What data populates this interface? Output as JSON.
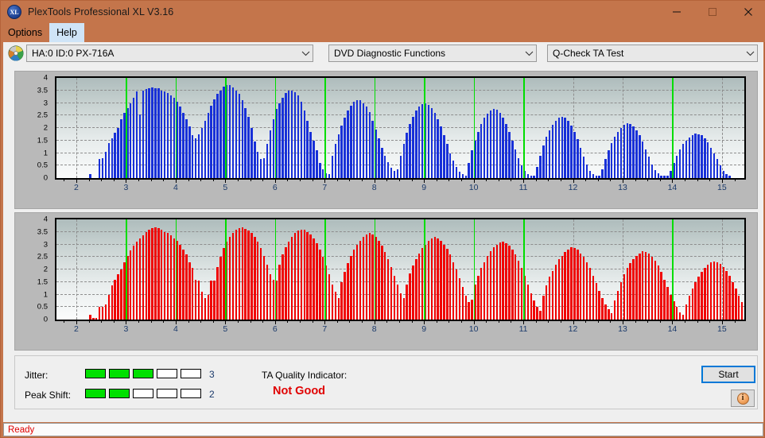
{
  "window": {
    "title": "PlexTools Professional XL V3.16",
    "app_icon": "xl-app-icon",
    "icon_text": "XL",
    "minimize": "minimize-icon",
    "maximize": "maximize-icon",
    "close": "close-icon",
    "accent_color": "#c4754b"
  },
  "menu": {
    "items": [
      {
        "label": "Options",
        "hover": false
      },
      {
        "label": "Help",
        "hover": true
      }
    ]
  },
  "toolbar": {
    "drive": {
      "value": "HA:0 ID:0  PX-716A",
      "icon": "disc-icon"
    },
    "function": {
      "value": "DVD Diagnostic Functions"
    },
    "test": {
      "value": "Q-Check TA Test"
    },
    "arrow_glyph": "⌄"
  },
  "footer": {
    "jitter_label": "Jitter:",
    "jitter_value": "3",
    "jitter_segments": 5,
    "jitter_filled": 3,
    "peak_label": "Peak Shift:",
    "peak_value": "2",
    "peak_segments": 5,
    "peak_filled": 2,
    "ta_label": "TA Quality Indicator:",
    "ta_verdict": "Not Good",
    "ta_verdict_color": "#e00000",
    "meter_on_color": "#00e000",
    "start_label": "Start",
    "info_glyph": "i"
  },
  "statusbar": {
    "text": "Ready",
    "color": "#e00000"
  },
  "chart_data": [
    {
      "id": "ta-test-jitter",
      "type": "bar",
      "title": "",
      "xlabel": "",
      "ylabel": "",
      "color": "#1830d8",
      "xlim": [
        1.6,
        15.45
      ],
      "ylim": [
        0,
        4
      ],
      "yticks": [
        0,
        0.5,
        1,
        1.5,
        2,
        2.5,
        3,
        3.5,
        4
      ],
      "ytick_labels": [
        "0",
        "0.5",
        "1",
        "1.5",
        "2",
        "2.5",
        "3",
        "3.5",
        "4"
      ],
      "xticks": [
        2,
        3,
        4,
        5,
        6,
        7,
        8,
        9,
        10,
        11,
        12,
        13,
        14,
        15
      ],
      "xtick_labels": [
        "2",
        "3",
        "4",
        "5",
        "6",
        "7",
        "8",
        "9",
        "10",
        "11",
        "12",
        "13",
        "14",
        "15"
      ],
      "grid": true,
      "markers": [
        3,
        4,
        5,
        6,
        7,
        8,
        9,
        10,
        11,
        14
      ],
      "marker_color": "#00dd00",
      "bar_step": 0.0625,
      "x_start": 2.28,
      "values": [
        0.15,
        0,
        0,
        0.75,
        0.78,
        1.05,
        1.4,
        1.6,
        1.8,
        2.0,
        2.35,
        2.6,
        2.8,
        3.0,
        3.2,
        3.45,
        2.55,
        3.5,
        3.55,
        3.6,
        3.62,
        3.6,
        3.58,
        3.5,
        3.45,
        3.4,
        3.3,
        3.2,
        3.05,
        2.85,
        2.6,
        2.35,
        2.05,
        1.7,
        1.6,
        1.75,
        2.0,
        2.3,
        2.6,
        2.9,
        3.15,
        3.35,
        3.5,
        3.65,
        3.72,
        3.7,
        3.62,
        3.5,
        3.35,
        3.1,
        2.8,
        2.45,
        2.0,
        1.45,
        1.05,
        0.75,
        0.8,
        1.35,
        1.9,
        2.35,
        2.75,
        3.0,
        3.2,
        3.4,
        3.5,
        3.48,
        3.42,
        3.3,
        3.05,
        2.7,
        2.3,
        1.85,
        1.5,
        1.1,
        0.6,
        0.35,
        0.2,
        0.15,
        0.9,
        1.35,
        1.75,
        2.1,
        2.4,
        2.7,
        2.9,
        3.05,
        3.12,
        3.1,
        3.0,
        2.85,
        2.62,
        2.3,
        1.95,
        1.6,
        1.2,
        0.9,
        0.65,
        0.4,
        0.3,
        0.35,
        0.9,
        1.35,
        1.8,
        2.15,
        2.45,
        2.7,
        2.85,
        2.95,
        2.98,
        2.92,
        2.8,
        2.6,
        2.35,
        2.05,
        1.7,
        1.35,
        1.0,
        0.7,
        0.45,
        0.25,
        0.15,
        0.1,
        0.6,
        1.1,
        1.5,
        1.85,
        2.15,
        2.4,
        2.58,
        2.7,
        2.76,
        2.72,
        2.6,
        2.42,
        2.15,
        1.85,
        1.5,
        1.15,
        0.8,
        0.5,
        0.28,
        0.15,
        0.1,
        0.08,
        0.45,
        0.9,
        1.3,
        1.65,
        1.9,
        2.12,
        2.3,
        2.4,
        2.45,
        2.42,
        2.3,
        2.1,
        1.85,
        1.55,
        1.2,
        0.85,
        0.55,
        0.3,
        0.15,
        0.1,
        0.08,
        0.35,
        0.75,
        1.1,
        1.4,
        1.65,
        1.85,
        2.0,
        2.12,
        2.18,
        2.15,
        2.05,
        1.9,
        1.7,
        1.45,
        1.15,
        0.85,
        0.55,
        0.32,
        0.18,
        0.1,
        0.08,
        0.08,
        0.3,
        0.6,
        0.9,
        1.15,
        1.35,
        1.5,
        1.62,
        1.72,
        1.78,
        1.76,
        1.7,
        1.58,
        1.42,
        1.22,
        1.0,
        0.75,
        0.5,
        0.3,
        0.15,
        0.08,
        0,
        0,
        0,
        0,
        0,
        0,
        0,
        0,
        0,
        0,
        0,
        0,
        0,
        0,
        0,
        0,
        0,
        0,
        0,
        0,
        0,
        0,
        0,
        0,
        0,
        0,
        0,
        0,
        0,
        0,
        0,
        0,
        0,
        0,
        0,
        0,
        0,
        0,
        0,
        0,
        0,
        0,
        0,
        0,
        0,
        0,
        0,
        0,
        0,
        0.85,
        0.25,
        0.45,
        0.7,
        1.0,
        1.35,
        1.65,
        1.9,
        2.05,
        2.1,
        2.0,
        1.9,
        1.75,
        1.5,
        1.2,
        0.9,
        0.65,
        0,
        0,
        0,
        0,
        0,
        0,
        0,
        0,
        0,
        0,
        0,
        0,
        0,
        0,
        0,
        0,
        0,
        0,
        0,
        0,
        0,
        0,
        0,
        0,
        0,
        0,
        0,
        0,
        0,
        0,
        0,
        0,
        0,
        0,
        0
      ]
    },
    {
      "id": "ta-test-peak-shift",
      "type": "bar",
      "title": "",
      "xlabel": "",
      "ylabel": "",
      "color": "#f00000",
      "xlim": [
        1.6,
        15.45
      ],
      "ylim": [
        0,
        4
      ],
      "yticks": [
        0,
        0.5,
        1,
        1.5,
        2,
        2.5,
        3,
        3.5,
        4
      ],
      "ytick_labels": [
        "0",
        "0.5",
        "1",
        "1.5",
        "2",
        "2.5",
        "3",
        "3.5",
        "4"
      ],
      "xticks": [
        2,
        3,
        4,
        5,
        6,
        7,
        8,
        9,
        10,
        11,
        12,
        13,
        14,
        15
      ],
      "xtick_labels": [
        "2",
        "3",
        "4",
        "5",
        "6",
        "7",
        "8",
        "9",
        "10",
        "11",
        "12",
        "13",
        "14",
        "15"
      ],
      "grid": true,
      "markers": [
        3,
        4,
        5,
        6,
        7,
        8,
        9,
        10,
        11,
        14
      ],
      "marker_color": "#00dd00",
      "bar_step": 0.0625,
      "x_start": 2.28,
      "values": [
        0.18,
        0.05,
        0.05,
        0.5,
        0.5,
        0.6,
        1.0,
        1.35,
        1.6,
        1.8,
        2.0,
        2.3,
        2.55,
        2.75,
        2.95,
        3.1,
        3.25,
        3.35,
        3.5,
        3.6,
        3.65,
        3.68,
        3.65,
        3.6,
        3.5,
        3.45,
        3.35,
        3.25,
        3.15,
        3.0,
        2.8,
        2.6,
        2.3,
        2.05,
        1.6,
        1.55,
        1.1,
        0.85,
        1.0,
        1.55,
        1.55,
        2.1,
        2.5,
        2.85,
        3.1,
        3.3,
        3.45,
        3.58,
        3.65,
        3.68,
        3.62,
        3.55,
        3.45,
        3.3,
        3.1,
        2.85,
        2.55,
        2.2,
        1.8,
        1.6,
        1.55,
        2.2,
        2.6,
        2.9,
        3.1,
        3.3,
        3.45,
        3.55,
        3.6,
        3.58,
        3.5,
        3.4,
        3.25,
        3.05,
        2.8,
        2.5,
        2.15,
        1.8,
        1.4,
        1.1,
        0.85,
        1.5,
        1.9,
        2.25,
        2.55,
        2.8,
        3.0,
        3.15,
        3.3,
        3.4,
        3.45,
        3.4,
        3.3,
        3.15,
        2.95,
        2.7,
        2.4,
        2.1,
        1.75,
        1.4,
        1.05,
        0.85,
        1.4,
        1.85,
        2.15,
        2.4,
        2.65,
        2.85,
        3.0,
        3.15,
        3.25,
        3.3,
        3.25,
        3.15,
        3.0,
        2.82,
        2.6,
        2.3,
        2.0,
        1.65,
        1.3,
        0.95,
        0.7,
        0.8,
        1.4,
        1.75,
        2.05,
        2.3,
        2.55,
        2.72,
        2.88,
        3.0,
        3.08,
        3.1,
        3.05,
        2.95,
        2.8,
        2.6,
        2.35,
        2.05,
        1.75,
        1.4,
        1.05,
        0.75,
        0.5,
        0.35,
        0.95,
        1.35,
        1.7,
        1.95,
        2.2,
        2.4,
        2.55,
        2.7,
        2.8,
        2.88,
        2.85,
        2.78,
        2.65,
        2.5,
        2.3,
        2.05,
        1.75,
        1.45,
        1.15,
        0.85,
        0.6,
        0.4,
        0.25,
        0.75,
        1.15,
        1.5,
        1.8,
        2.05,
        2.25,
        2.4,
        2.55,
        2.65,
        2.72,
        2.7,
        2.62,
        2.5,
        2.35,
        2.15,
        1.9,
        1.6,
        1.3,
        1.0,
        0.72,
        0.5,
        0.3,
        0.18,
        0.6,
        0.95,
        1.25,
        1.5,
        1.72,
        1.9,
        2.05,
        2.18,
        2.28,
        2.32,
        2.3,
        2.22,
        2.1,
        1.95,
        1.75,
        1.5,
        1.25,
        0.95,
        0.7,
        0.5,
        0.3,
        0.18,
        0.1,
        0.75,
        0,
        0.2,
        0.6,
        0.9,
        1.15,
        1.35,
        1.5,
        1.6,
        1.65,
        1.65,
        1.6,
        1.5,
        1.35,
        1.15,
        0.9,
        0.65,
        0.75,
        0.12,
        0,
        0,
        0,
        0,
        0,
        0,
        0,
        0,
        0,
        0,
        0,
        0,
        0,
        0,
        0,
        0,
        0,
        0,
        0,
        0,
        0,
        0,
        0,
        0,
        0,
        0,
        0,
        0,
        0,
        0,
        0,
        0,
        0,
        0,
        0,
        0,
        0,
        0,
        0,
        0,
        0,
        0,
        0,
        0,
        0.1,
        0.12,
        0.15,
        0.2,
        0.9,
        1.0,
        1.15,
        1.2,
        0.95,
        1.0,
        0.85,
        0.2,
        0.18,
        0.15,
        0,
        0,
        0,
        0,
        0,
        0,
        0,
        0,
        0,
        0,
        0,
        0,
        0,
        0,
        0,
        0,
        0,
        0,
        0,
        0,
        0,
        0,
        0,
        0,
        0,
        0,
        0,
        0,
        0,
        0,
        0,
        0,
        0,
        0,
        0,
        0
      ]
    }
  ]
}
